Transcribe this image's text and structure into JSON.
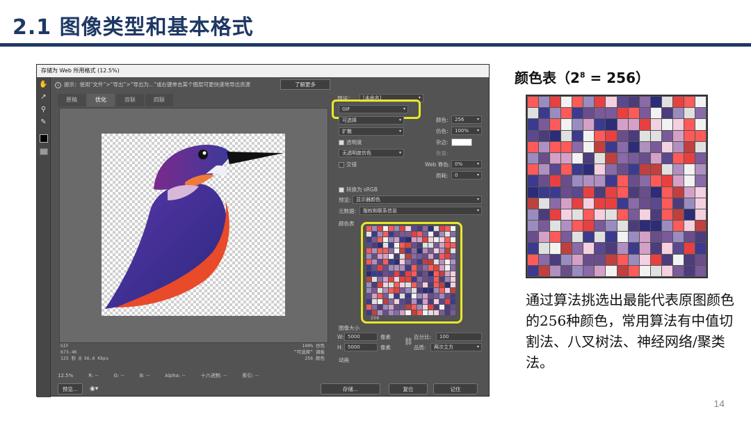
{
  "slide": {
    "title": "2.1 图像类型和基本格式",
    "page_number": "14"
  },
  "color_table": {
    "heading_prefix": "颜色表（2",
    "heading_sup": "8",
    "heading_suffix": " = 256）",
    "description": "通过算法挑选出最能代表原图颜色的256种颜色，常用算法有中值切割法、八叉树法、神经网络/聚类法。"
  },
  "ps": {
    "window_title": "存储为 Web 所用格式 (12.5%)",
    "hint": "提示：使用“文件”>“导出”>“导出为...”或右键单击某个图层可更快速地导出资源",
    "learn_more": "了解更多",
    "tabs": [
      "原稿",
      "优化",
      "双联",
      "四联"
    ],
    "status_left": [
      "GIF",
      "673.4K",
      "125 秒 @ 56.6 Kbps"
    ],
    "status_right": [
      "100% 仿色",
      "“可选择” 调板",
      "256 颜色"
    ],
    "bottom_info": [
      "12.5%",
      "R: --",
      "G: --",
      "B: --",
      "Alpha: --",
      "十六进制: --",
      "索引: --"
    ],
    "preview_label": "预览...",
    "preset_label": "预设：",
    "preset_value": "[未命名]",
    "format_value": "GIF",
    "reduction_value": "可选择",
    "dither_value": "扩散",
    "colors_label": "颜色:",
    "colors_value": "256",
    "dither_amt_label": "仿色:",
    "dither_amt_value": "100%",
    "transparency_label": "透明度",
    "matte_label": "杂边:",
    "no_trans_dither": "无透明度仿色",
    "amount_label": "数量:",
    "interlaced_label": "交错",
    "web_snap_label": "Web 靠色:",
    "web_snap_value": "0%",
    "lossy_label": "损耗:",
    "lossy_value": "0",
    "convert_srgb": "转换为 sRGB",
    "preview_mode_label": "预览:",
    "preview_mode_value": "显示器颜色",
    "metadata_label": "元数据:",
    "metadata_value": "版权和联系信息",
    "color_table_label": "颜色表",
    "palette_count": "256",
    "image_size_label": "图像大小",
    "w_label": "W:",
    "w_value": "5000",
    "h_label": "H:",
    "h_value": "5000",
    "px_unit": "像素",
    "percent_label": "百分比:",
    "percent_value": "100",
    "quality_label": "品质:",
    "quality_value": "两次立方",
    "animation_label": "动画",
    "save_button": "存储...",
    "reset_button": "复位",
    "remember_button": "记住"
  },
  "colors": {
    "title_blue": "#1f3864",
    "highlight_yellow": "#e8e82a"
  },
  "palette_colors": [
    "#6a4e8c",
    "#e84040",
    "#3c3a8e",
    "#f2f2f2",
    "#8a6aa8",
    "#d4a0c8",
    "#4c3c7c",
    "#ff5a5a",
    "#9a8cc0",
    "#5a4890",
    "#e0e0e0",
    "#c04040",
    "#2c2c78",
    "#b090c0",
    "#f4d0e0",
    "#7a5a9a"
  ]
}
